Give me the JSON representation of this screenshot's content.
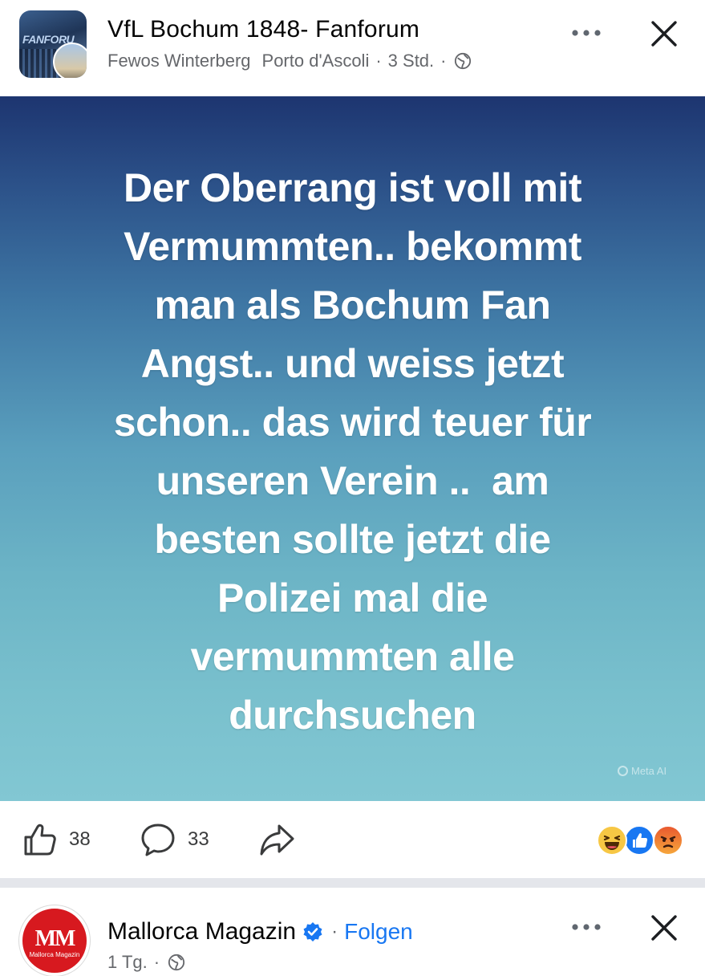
{
  "post": {
    "page_name": "VfL Bochum 1848- Fanforum",
    "author_1": "Fewos Winterberg",
    "author_2": "Porto d'Ascoli",
    "separator": "·",
    "time": "3 Std.",
    "privacy_icon": "globe-icon",
    "avatar_text": "FANFORU",
    "image_text_lines": [
      "Der Oberrang ist voll mit",
      "Vermummten.. bekommt",
      "man als Bochum Fan",
      "Angst.. und weiss jetzt",
      "schon.. das wird teuer für",
      "unseren Verein ..  am",
      "besten sollte jetzt die",
      "Polizei mal die",
      "vermummten alle",
      "durchsuchen"
    ],
    "watermark": "Meta AI",
    "likes_count": "38",
    "comments_count": "33",
    "reactions": [
      "haha",
      "like",
      "angry"
    ],
    "colors": {
      "gradient_top": "#1d3570",
      "gradient_bottom": "#82c7d3",
      "link_blue": "#1877f2",
      "meta_gray": "#65676b"
    }
  },
  "next_post": {
    "page_name": "Mallorca Magazin",
    "verified": true,
    "separator": "·",
    "follow_label": "Folgen",
    "time": "1 Tg.",
    "logo_text": "MM",
    "logo_subtext": "Mallorca Magazin"
  }
}
